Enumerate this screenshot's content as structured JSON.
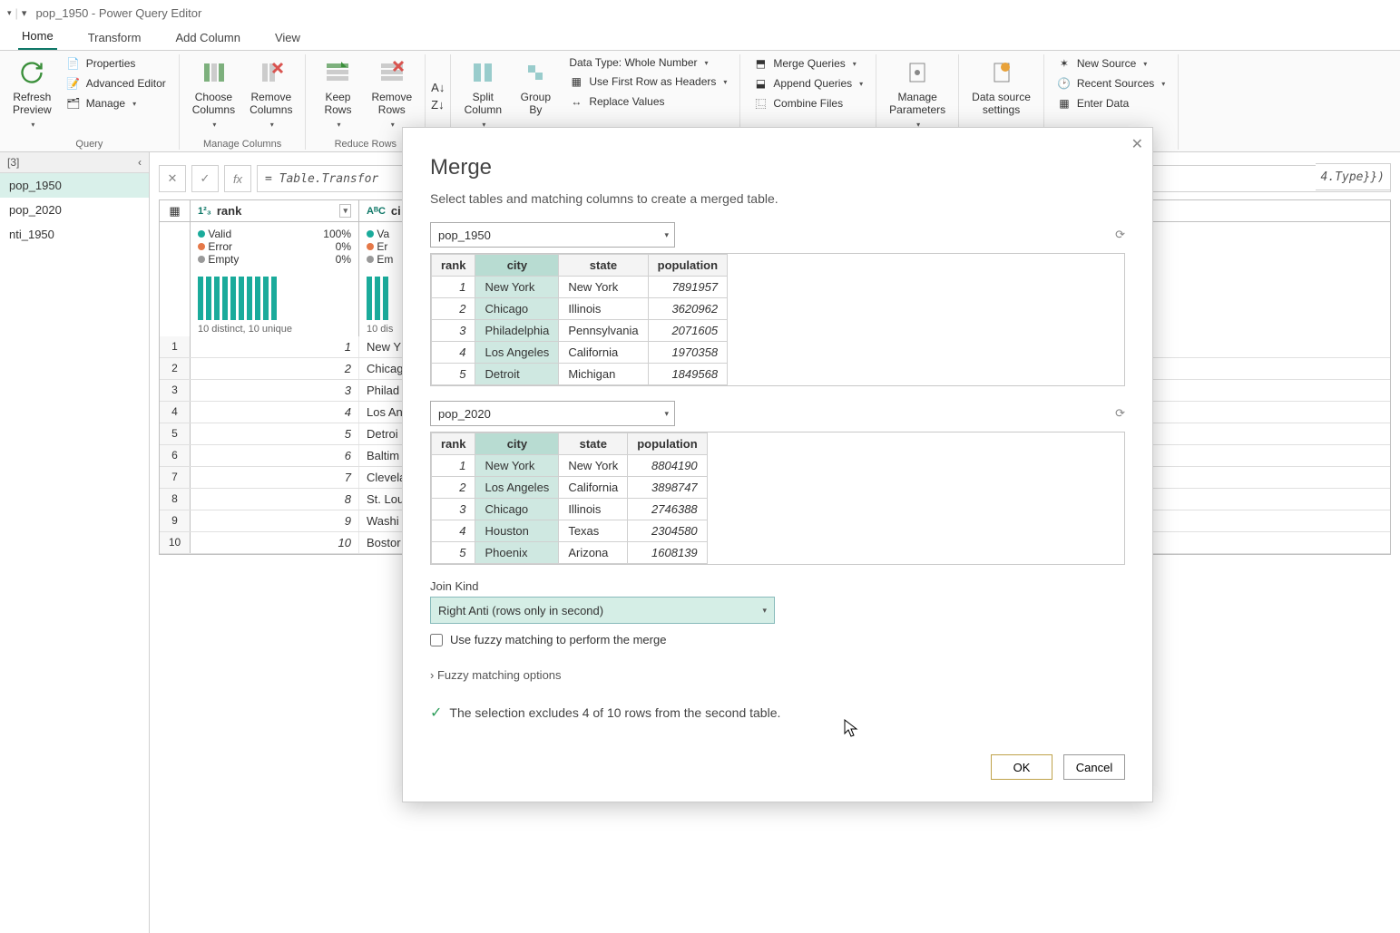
{
  "window": {
    "title": "pop_1950 - Power Query Editor"
  },
  "tabs": {
    "home": "Home",
    "transform": "Transform",
    "add_column": "Add Column",
    "view": "View"
  },
  "ribbon": {
    "refresh": "Refresh\nPreview",
    "properties": "Properties",
    "advanced_editor": "Advanced Editor",
    "manage": "Manage",
    "query_group": "Query",
    "choose_columns": "Choose\nColumns",
    "remove_columns": "Remove\nColumns",
    "manage_columns_group": "Manage Columns",
    "keep_rows": "Keep\nRows",
    "remove_rows": "Remove\nRows",
    "reduce_rows_group": "Reduce Rows",
    "split_column": "Split\nColumn",
    "group_by": "Group\nBy",
    "data_type": "Data Type: Whole Number",
    "use_first_row": "Use First Row as Headers",
    "replace_values": "Replace Values",
    "merge_queries": "Merge Queries",
    "append_queries": "Append Queries",
    "combine_files": "Combine Files",
    "manage_parameters": "Manage\nParameters",
    "data_source_settings": "Data source\nsettings",
    "new_source": "New Source",
    "recent_sources": "Recent Sources",
    "enter_data": "Enter Data"
  },
  "queries": {
    "header": "[3]",
    "items": [
      "pop_1950",
      "pop_2020",
      "nti_1950"
    ]
  },
  "formula": {
    "prefix": "= Table.Transfor",
    "suffix": "4.Type}})"
  },
  "grid": {
    "col1": {
      "type": "1²₃",
      "name": "rank"
    },
    "col2": {
      "type": "AᴮC",
      "name": "ci"
    },
    "quality": {
      "valid": "Valid",
      "error": "Error",
      "empty": "Empty",
      "valid_pct": "100%",
      "error_pct": "0%",
      "empty_pct": "0%",
      "va": "Va",
      "er": "Er",
      "em": "Em"
    },
    "distinct": "10 distinct, 10 unique",
    "distinct2": "10 dis",
    "rows": [
      {
        "n": "1",
        "rank": "1",
        "city": "New Y"
      },
      {
        "n": "2",
        "rank": "2",
        "city": "Chicag"
      },
      {
        "n": "3",
        "rank": "3",
        "city": "Philad"
      },
      {
        "n": "4",
        "rank": "4",
        "city": "Los An"
      },
      {
        "n": "5",
        "rank": "5",
        "city": "Detroi"
      },
      {
        "n": "6",
        "rank": "6",
        "city": "Baltim"
      },
      {
        "n": "7",
        "rank": "7",
        "city": "Clevela"
      },
      {
        "n": "8",
        "rank": "8",
        "city": "St. Lou"
      },
      {
        "n": "9",
        "rank": "9",
        "city": "Washi"
      },
      {
        "n": "10",
        "rank": "10",
        "city": "Bostor"
      }
    ]
  },
  "modal": {
    "title": "Merge",
    "subtitle": "Select tables and matching columns to create a merged table.",
    "table1": "pop_1950",
    "table2": "pop_2020",
    "preview1": {
      "headers": [
        "rank",
        "city",
        "state",
        "population"
      ],
      "rows": [
        {
          "rank": "1",
          "city": "New York",
          "state": "New York",
          "population": "7891957"
        },
        {
          "rank": "2",
          "city": "Chicago",
          "state": "Illinois",
          "population": "3620962"
        },
        {
          "rank": "3",
          "city": "Philadelphia",
          "state": "Pennsylvania",
          "population": "2071605"
        },
        {
          "rank": "4",
          "city": "Los Angeles",
          "state": "California",
          "population": "1970358"
        },
        {
          "rank": "5",
          "city": "Detroit",
          "state": "Michigan",
          "population": "1849568"
        }
      ]
    },
    "preview2": {
      "headers": [
        "rank",
        "city",
        "state",
        "population"
      ],
      "rows": [
        {
          "rank": "1",
          "city": "New York",
          "state": "New York",
          "population": "8804190"
        },
        {
          "rank": "2",
          "city": "Los Angeles",
          "state": "California",
          "population": "3898747"
        },
        {
          "rank": "3",
          "city": "Chicago",
          "state": "Illinois",
          "population": "2746388"
        },
        {
          "rank": "4",
          "city": "Houston",
          "state": "Texas",
          "population": "2304580"
        },
        {
          "rank": "5",
          "city": "Phoenix",
          "state": "Arizona",
          "population": "1608139"
        }
      ]
    },
    "join_kind_label": "Join Kind",
    "join_kind": "Right Anti (rows only in second)",
    "fuzzy_label": "Use fuzzy matching to perform the merge",
    "fuzzy_options": "Fuzzy matching options",
    "status": "The selection excludes 4 of 10 rows from the second table.",
    "ok": "OK",
    "cancel": "Cancel"
  }
}
